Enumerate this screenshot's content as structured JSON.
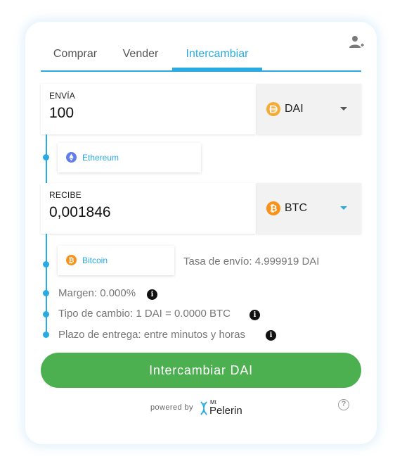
{
  "tabs": [
    {
      "label": "Comprar"
    },
    {
      "label": "Vender"
    },
    {
      "label": "Intercambiar"
    }
  ],
  "send": {
    "label": "ENVÍA",
    "value": "100",
    "currency": "DAI",
    "network": "Ethereum"
  },
  "receive": {
    "label": "RECIBE",
    "value": "0,001846",
    "currency": "BTC",
    "network": "Bitcoin"
  },
  "details": {
    "rate": "Tasa de envío: 4.999919 DAI",
    "margin": "Margen: 0.000%",
    "exchange": "Tipo de cambio: 1 DAI = 0.0000 BTC",
    "delivery": "Plazo de entrega: entre minutos y horas"
  },
  "cta_label": "Intercambiar DAI",
  "footer": {
    "powered_by": "powered by",
    "brand_mt": "Mt",
    "brand_name": "Pelerin"
  },
  "colors": {
    "accent": "#29abe2",
    "cta": "#4caf50",
    "dai": "#f5ac37",
    "btc": "#f7931a",
    "eth": "#627eea"
  },
  "icons": {
    "user": "user-switch-icon",
    "dai": "dai-coin-icon",
    "btc": "bitcoin-coin-icon",
    "eth": "ethereum-icon",
    "info": "info-icon",
    "help": "help-icon"
  }
}
